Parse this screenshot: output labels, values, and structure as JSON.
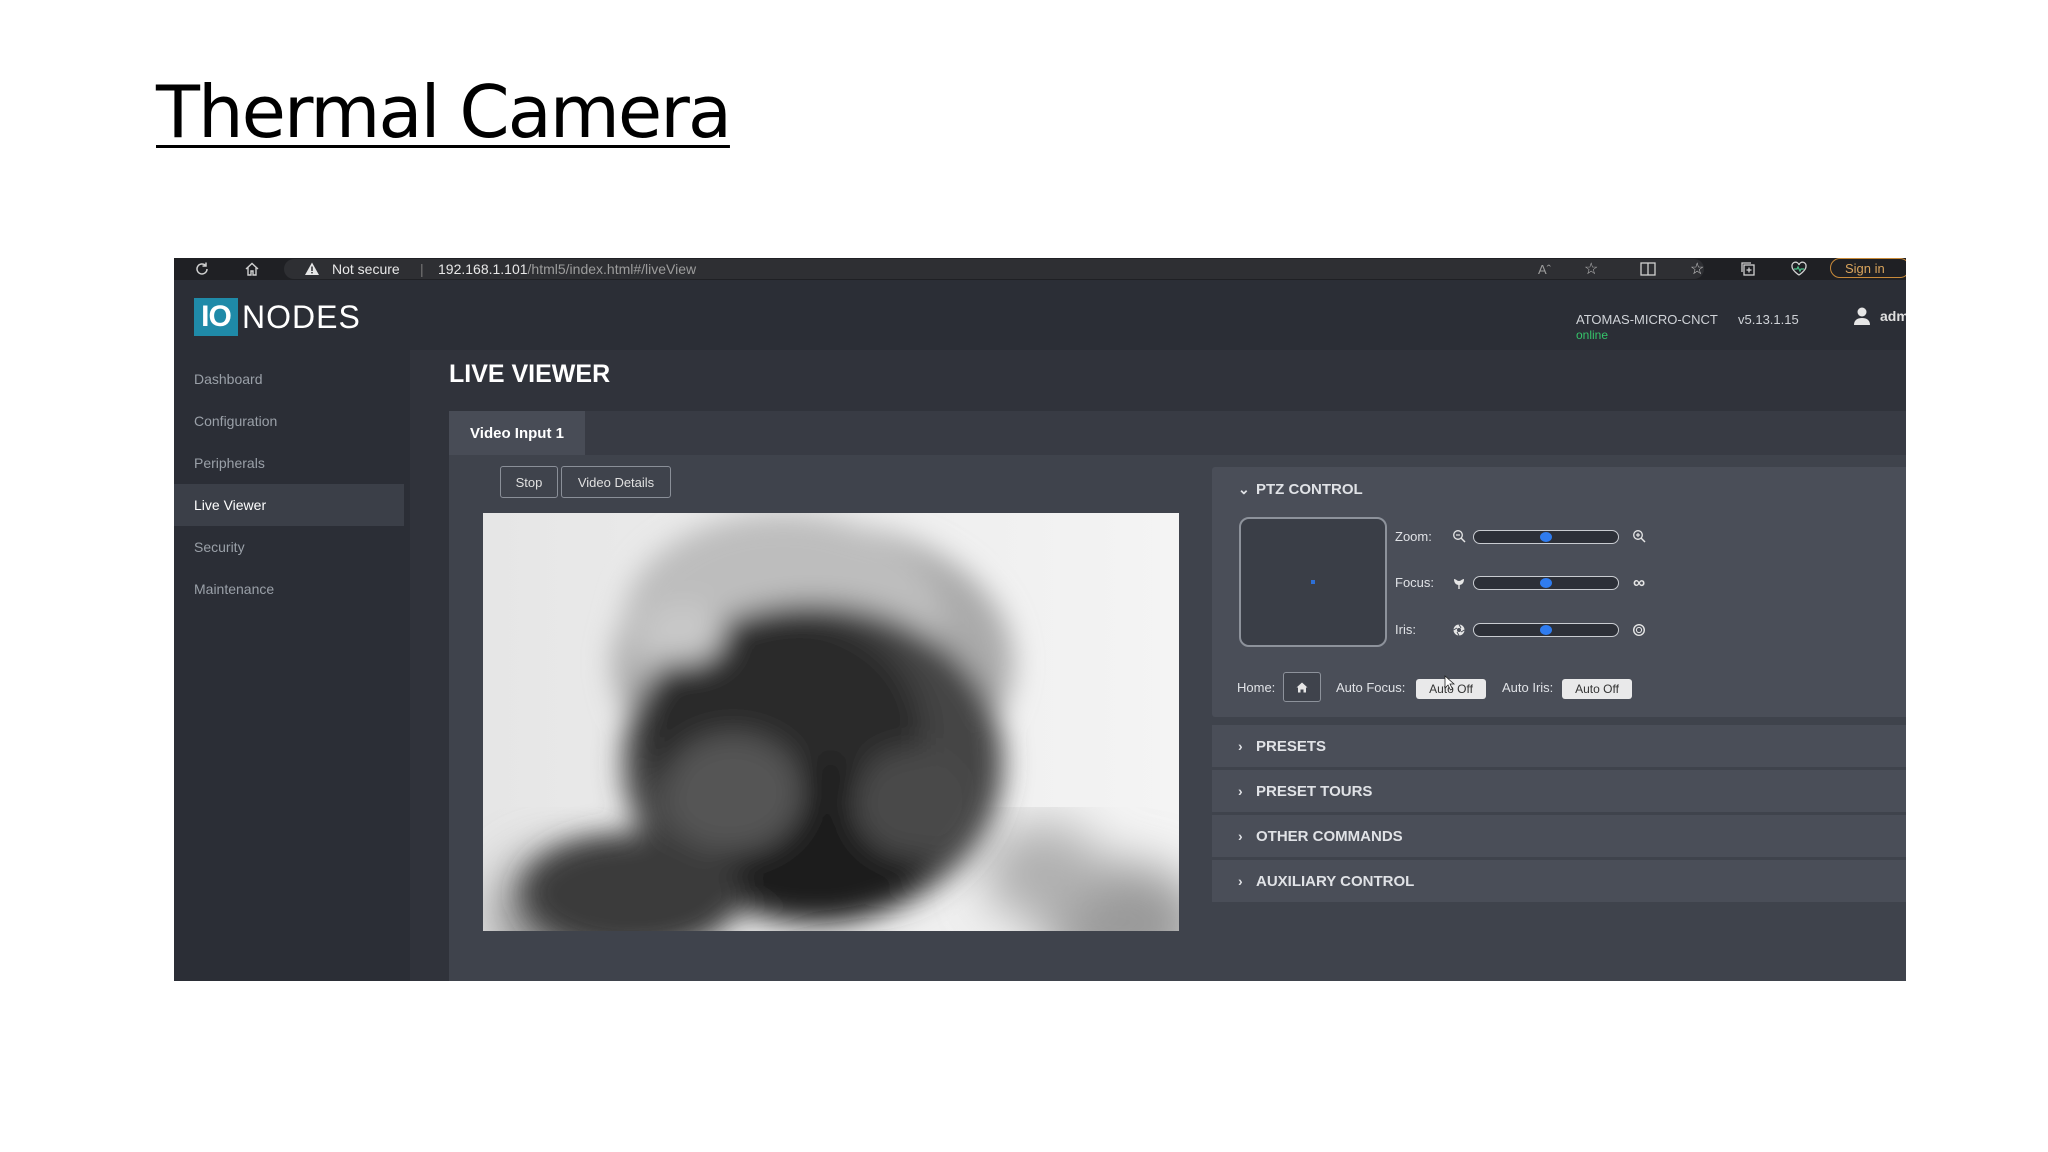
{
  "slide": {
    "title": "Thermal Camera"
  },
  "browser": {
    "security_label": "Not secure",
    "url_host": "192.168.1.101",
    "url_path": "/html5/index.html#/liveView",
    "sign_in_label": "Sign in"
  },
  "header": {
    "logo_io": "IO",
    "logo_nodes": "NODES",
    "device_name": "ATOMAS-MICRO-CNCT",
    "device_status": "online",
    "version": "v5.13.1.15",
    "user": "adm"
  },
  "sidebar": {
    "items": [
      {
        "label": "Dashboard",
        "active": false
      },
      {
        "label": "Configuration",
        "active": false
      },
      {
        "label": "Peripherals",
        "active": false
      },
      {
        "label": "Live Viewer",
        "active": true
      },
      {
        "label": "Security",
        "active": false
      },
      {
        "label": "Maintenance",
        "active": false
      }
    ]
  },
  "main": {
    "title": "LIVE VIEWER",
    "tab": "Video Input 1",
    "stop_label": "Stop",
    "details_label": "Video Details"
  },
  "ptz": {
    "title": "PTZ CONTROL",
    "zoom_label": "Zoom:",
    "focus_label": "Focus:",
    "iris_label": "Iris:",
    "zoom_level": 0.5,
    "focus_level": 0.5,
    "iris_level": 0.5,
    "home_label": "Home:",
    "auto_focus_label": "Auto Focus:",
    "auto_focus_value": "Auto Off",
    "auto_iris_label": "Auto Iris:",
    "auto_iris_value": "Auto Off"
  },
  "sections": {
    "presets": "PRESETS",
    "preset_tours": "PRESET TOURS",
    "other_commands": "OTHER COMMANDS",
    "auxiliary_control": "AUXILIARY CONTROL"
  },
  "colors": {
    "accent_blue": "#2f7cf0",
    "logo_teal": "#1f8aa8",
    "online_green": "#35c46a",
    "signin_orange": "#d9a45c"
  }
}
